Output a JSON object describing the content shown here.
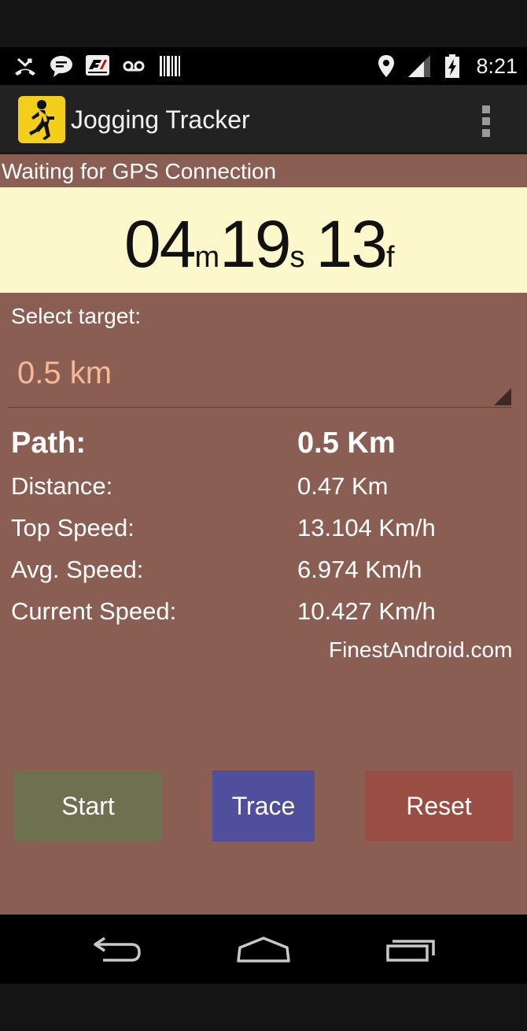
{
  "status_bar": {
    "time": "8:21",
    "left_icons": [
      "missed-call-icon",
      "chat-bubble-icon",
      "f1-app-icon",
      "voicemail-icon",
      "barcode-icon"
    ],
    "right_icons": [
      "location-pin-icon",
      "cell-signal-icon",
      "battery-charging-icon"
    ]
  },
  "action_bar": {
    "title": "Jogging Tracker",
    "app_icon": "runner-icon",
    "overflow_icon": "overflow-menu-icon"
  },
  "gps_status": "Waiting for GPS Connection",
  "timer": {
    "minutes": "04",
    "minutes_unit": "m",
    "seconds": "19",
    "seconds_unit": "s",
    "frames": "13",
    "frames_unit": "f"
  },
  "target": {
    "label": "Select target:",
    "selected": "0.5 km"
  },
  "stats": {
    "path_label": "Path:",
    "path_value": "0.5 Km",
    "distance_label": "Distance:",
    "distance_value": "0.47 Km",
    "top_speed_label": "Top Speed:",
    "top_speed_value": "13.104 Km/h",
    "avg_speed_label": "Avg. Speed:",
    "avg_speed_value": "6.974 Km/h",
    "current_speed_label": "Current Speed:",
    "current_speed_value": "10.427 Km/h"
  },
  "credit": "FinestAndroid.com",
  "buttons": {
    "start": "Start",
    "trace": "Trace",
    "reset": "Reset"
  },
  "colors": {
    "content_bg": "#8a5e52",
    "timer_bg": "#fdf8cb",
    "spinner_text": "#f7b898",
    "start_btn": "#6d7150",
    "trace_btn": "#4f4f9d",
    "reset_btn": "#9a4d42",
    "app_icon_bg": "#f4cf1a"
  },
  "nav_bar": {
    "icons": [
      "back-icon",
      "home-icon",
      "recents-icon"
    ]
  }
}
